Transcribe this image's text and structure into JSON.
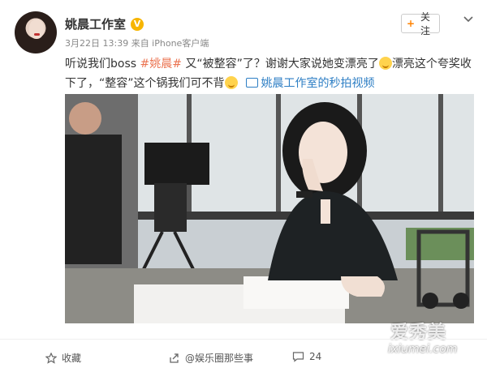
{
  "post": {
    "author": "姚晨工作室",
    "verified_badge": "V",
    "meta": "3月22日 13:39 来自 iPhone客户端",
    "follow_label": "关注",
    "follow_plus": "+",
    "more_icon": "chevron-down-icon",
    "text_part1": "听说我们boss ",
    "tag": "#姚晨#",
    "text_part2": " 又“被整容”了？谢谢大家说她变漂亮了",
    "text_part3": "漂亮这个夸奖收下了，“整容”这个锅我们可不背",
    "video_link": "姚晨工作室的秒拍视频"
  },
  "footer": {
    "favorite_label": "收藏",
    "favorite_icon": "star-icon",
    "share_icon": "share-icon",
    "share_overlay": "@娱乐圈那些事",
    "comment_icon": "comment-icon",
    "comment_count": "24"
  },
  "watermark": {
    "brand": "爱秀美",
    "url": "ixiumei.com"
  },
  "colors": {
    "tag": "#eb7350",
    "link": "#2d7ec4",
    "verified": "#f7b500"
  }
}
